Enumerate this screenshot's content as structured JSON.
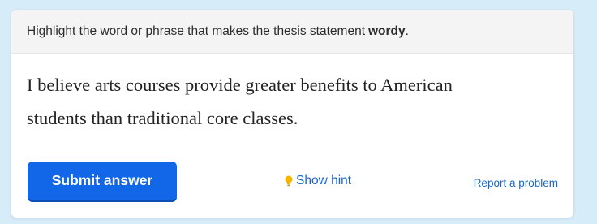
{
  "prompt": {
    "text": "Highlight the word or phrase that makes the thesis statement",
    "bold_word": "wordy",
    "end": "."
  },
  "sentence": {
    "line1": [
      "I",
      "believe",
      "arts",
      "courses",
      "provide",
      "greater",
      "benefits",
      "to",
      "American"
    ],
    "line2": [
      "students",
      "than",
      "traditional",
      "core",
      "classes."
    ]
  },
  "actions": {
    "submit_label": "Submit answer",
    "hint_label": "Show hint",
    "report_label": "Report a problem"
  },
  "icons": {
    "hint": "lightbulb-icon"
  },
  "colors": {
    "background": "#d6ecf8",
    "primary": "#1167e8",
    "link": "#1a66c9",
    "bulb": "#f5b400"
  }
}
